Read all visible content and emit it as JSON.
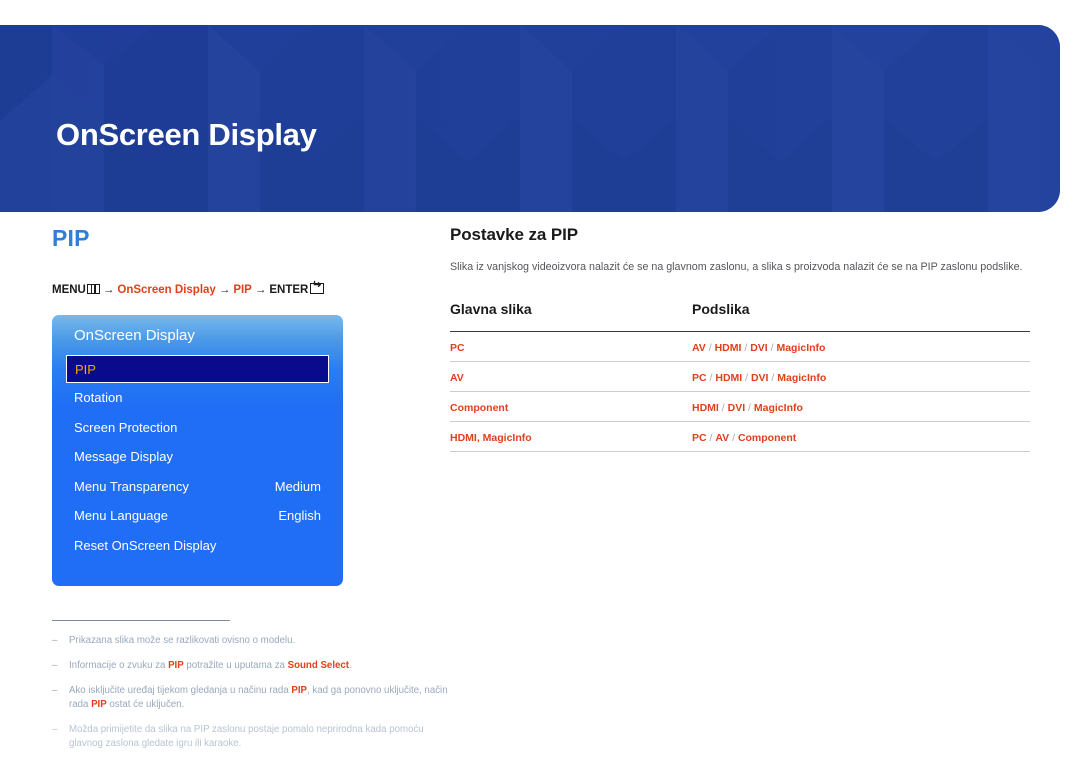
{
  "header": {
    "title": "OnScreen Display",
    "bg_color": "#21409a"
  },
  "left": {
    "section_title": "PIP",
    "accent_color": "#2f7fd6",
    "breadcrumb": {
      "menu_label": "MENU",
      "menu_icon": "menu-bars-icon",
      "arrow": "→",
      "step1": "OnScreen Display",
      "step2": "PIP",
      "enter_label": "ENTER",
      "enter_icon": "enter-return-icon",
      "accent_color": "#e0401b"
    },
    "osd": {
      "title": "OnScreen Display",
      "items": [
        {
          "label": "PIP",
          "value": "",
          "selected": true
        },
        {
          "label": "Rotation",
          "value": "",
          "selected": false
        },
        {
          "label": "Screen Protection",
          "value": "",
          "selected": false
        },
        {
          "label": "Message Display",
          "value": "",
          "selected": false
        },
        {
          "label": "Menu Transparency",
          "value": "Medium",
          "selected": false
        },
        {
          "label": "Menu Language",
          "value": "English",
          "selected": false
        },
        {
          "label": "Reset OnScreen Display",
          "value": "",
          "selected": false
        }
      ],
      "selected_bg": "#0a0a8c",
      "selected_text": "#f2a900"
    },
    "notes": [
      {
        "parts": [
          {
            "t": "Prikazana slika može se razlikovati ovisno o modelu.",
            "a": false
          }
        ],
        "dim": false
      },
      {
        "parts": [
          {
            "t": "Informacije o zvuku za ",
            "a": false
          },
          {
            "t": "PIP",
            "a": true
          },
          {
            "t": " potražite u uputama za ",
            "a": false
          },
          {
            "t": "Sound Select",
            "a": true
          },
          {
            "t": ".",
            "a": false
          }
        ],
        "dim": false
      },
      {
        "parts": [
          {
            "t": "Ako isključite uređaj tijekom gledanja u načinu rada ",
            "a": false
          },
          {
            "t": "PIP",
            "a": true
          },
          {
            "t": ", kad ga ponovno uključite, način rada ",
            "a": false
          },
          {
            "t": "PIP",
            "a": true
          },
          {
            "t": " ostat će uključen.",
            "a": false
          }
        ],
        "dim": false
      },
      {
        "parts": [
          {
            "t": "Možda primijetite da slika na PIP zaslonu postaje pomalo neprirodna kada pomoću glavnog zaslona gledate igru ili karaoke.",
            "a": false
          }
        ],
        "dim": true
      }
    ]
  },
  "right": {
    "sub_title": "Postavke za PIP",
    "description": "Slika iz vanjskog videoizvora nalazit će se na glavnom zaslonu, a slika s proizvoda nalazit će se na PIP zaslonu podslike.",
    "table": {
      "headers": [
        "Glavna slika",
        "Podslika"
      ],
      "rows": [
        {
          "main": "PC",
          "sub": [
            "AV",
            "HDMI",
            "DVI",
            "MagicInfo"
          ]
        },
        {
          "main": "AV",
          "sub": [
            "PC",
            "HDMI",
            "DVI",
            "MagicInfo"
          ]
        },
        {
          "main": "Component",
          "sub": [
            "HDMI",
            "DVI",
            "MagicInfo"
          ]
        },
        {
          "main": "HDMI, MagicInfo",
          "sub": [
            "PC",
            "AV",
            "Component"
          ]
        }
      ],
      "separator": "/",
      "text_color": "#e0401b"
    }
  }
}
